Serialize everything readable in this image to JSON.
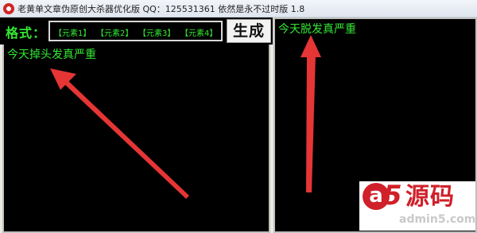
{
  "window": {
    "title": "老黄单文章伪原创大杀器优化版 QQ：125531361 依然是永不过时版 1.8"
  },
  "toolbar": {
    "format_label": "格式：",
    "elements": [
      "【元素1】",
      "【元素2】",
      "【元素3】",
      "【元素4】"
    ],
    "generate_label": "生成"
  },
  "left_pane": {
    "text": "今天掉头发真严重"
  },
  "right_pane": {
    "text": "今天脱发真严重"
  },
  "watermark": {
    "logo_a": "a",
    "logo_5": "5",
    "chinese": "源码",
    "domain": "admin5.com"
  },
  "colors": {
    "text_green": "#33e833",
    "pane_bg": "#000000",
    "arrow_red": "#e53535",
    "watermark_red": "#d0202a"
  }
}
